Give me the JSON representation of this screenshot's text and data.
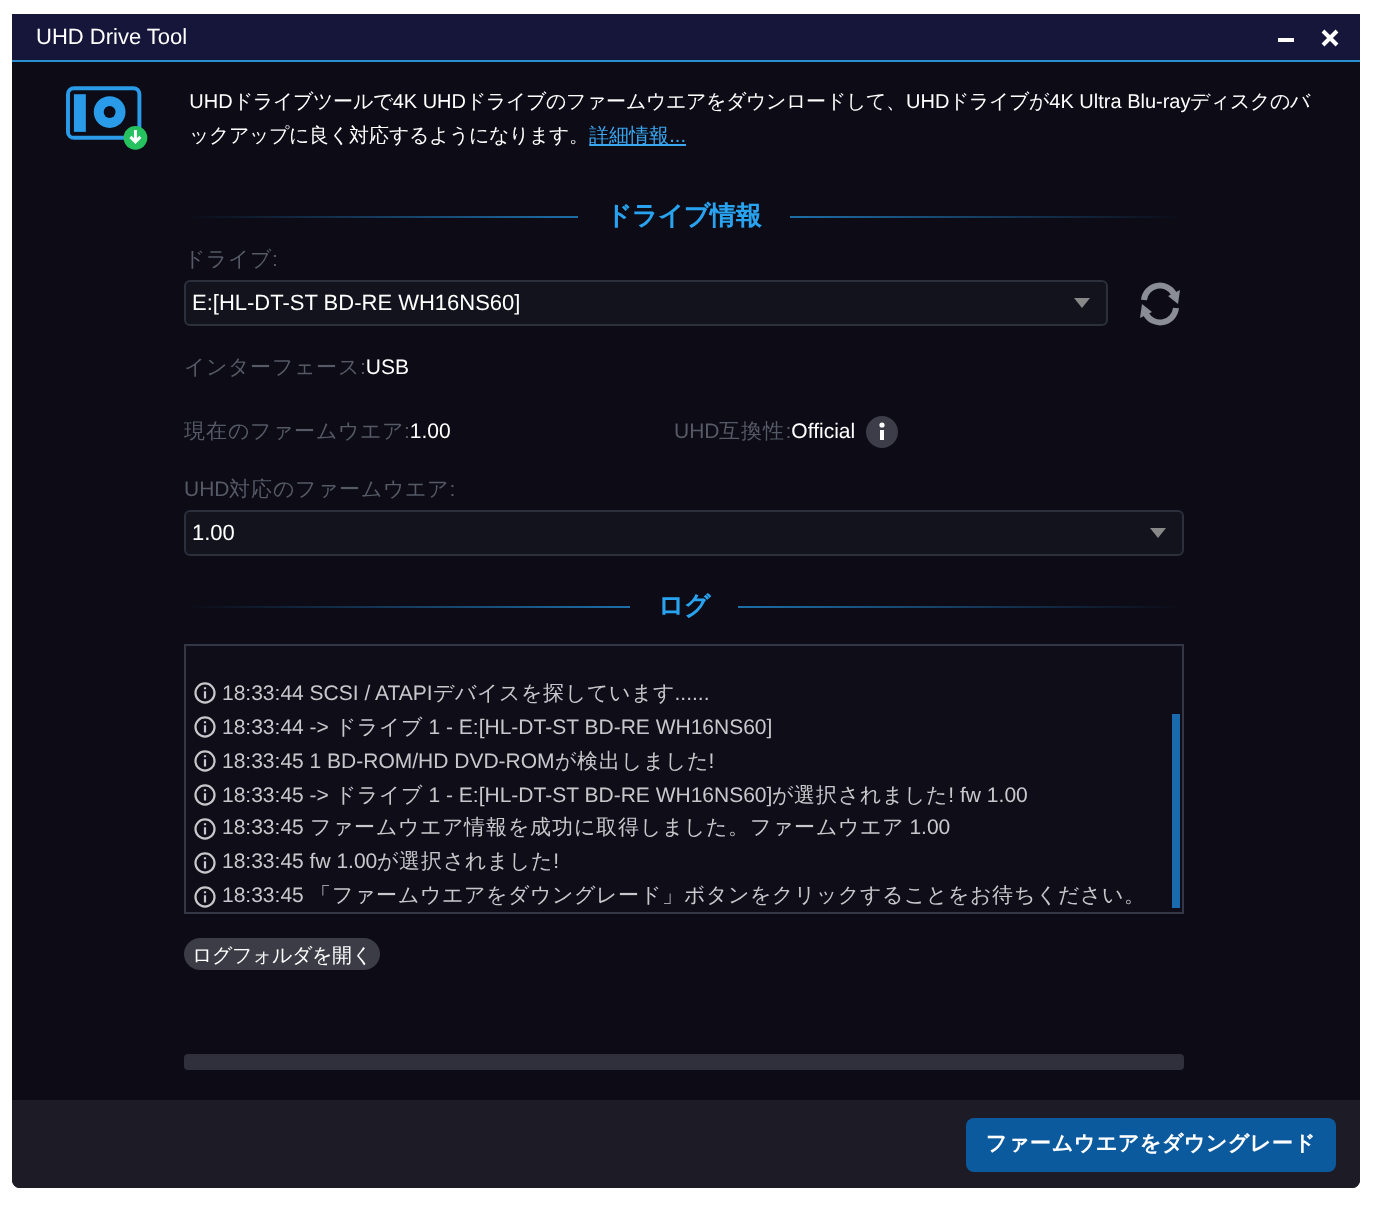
{
  "window": {
    "title": "UHD Drive Tool"
  },
  "intro": {
    "text": "UHDドライブツールで4K UHDドライブのファームウエアをダウンロードして、UHDドライブが4K Ultra Blu-rayディスクのバックアップに良く対応するようになります。",
    "link": "詳細情報..."
  },
  "drive_info": {
    "heading": "ドライブ情報",
    "drive": {
      "label": "ドライブ:",
      "value": "E:[HL-DT-ST BD-RE  WH16NS60]"
    },
    "interface": {
      "label": "インターフェース:",
      "value": "USB"
    },
    "current_firmware": {
      "label": "現在のファームウエア:",
      "value": "1.00"
    },
    "uhd_compat": {
      "label": "UHD互換性:",
      "value": "Official"
    },
    "uhd_firmware": {
      "label": "UHD対応のファームウエア:",
      "value": "1.00"
    }
  },
  "log": {
    "heading": "ログ",
    "entries": [
      "18:33:44 SCSI / ATAPIデバイスを探しています......",
      "18:33:44 -> ドライブ 1 - E:[HL-DT-ST BD-RE WH16NS60]",
      "18:33:45 1 BD-ROM/HD DVD-ROMが検出しました!",
      "18:33:45 -> ドライブ 1 - E:[HL-DT-ST BD-RE WH16NS60]が選択されました! fw 1.00",
      "18:33:45 ファームウエア情報を成功に取得しました。ファームウエア 1.00",
      "18:33:45 fw 1.00が選択されました!",
      "18:33:45 「ファームウエアをダウングレード」ボタンをクリックすることをお待ちください。"
    ],
    "open_folder": "ログフォルダを開く"
  },
  "progress": {
    "level": 0
  },
  "footer": {
    "button": "ファームウエアをダウングレード"
  }
}
